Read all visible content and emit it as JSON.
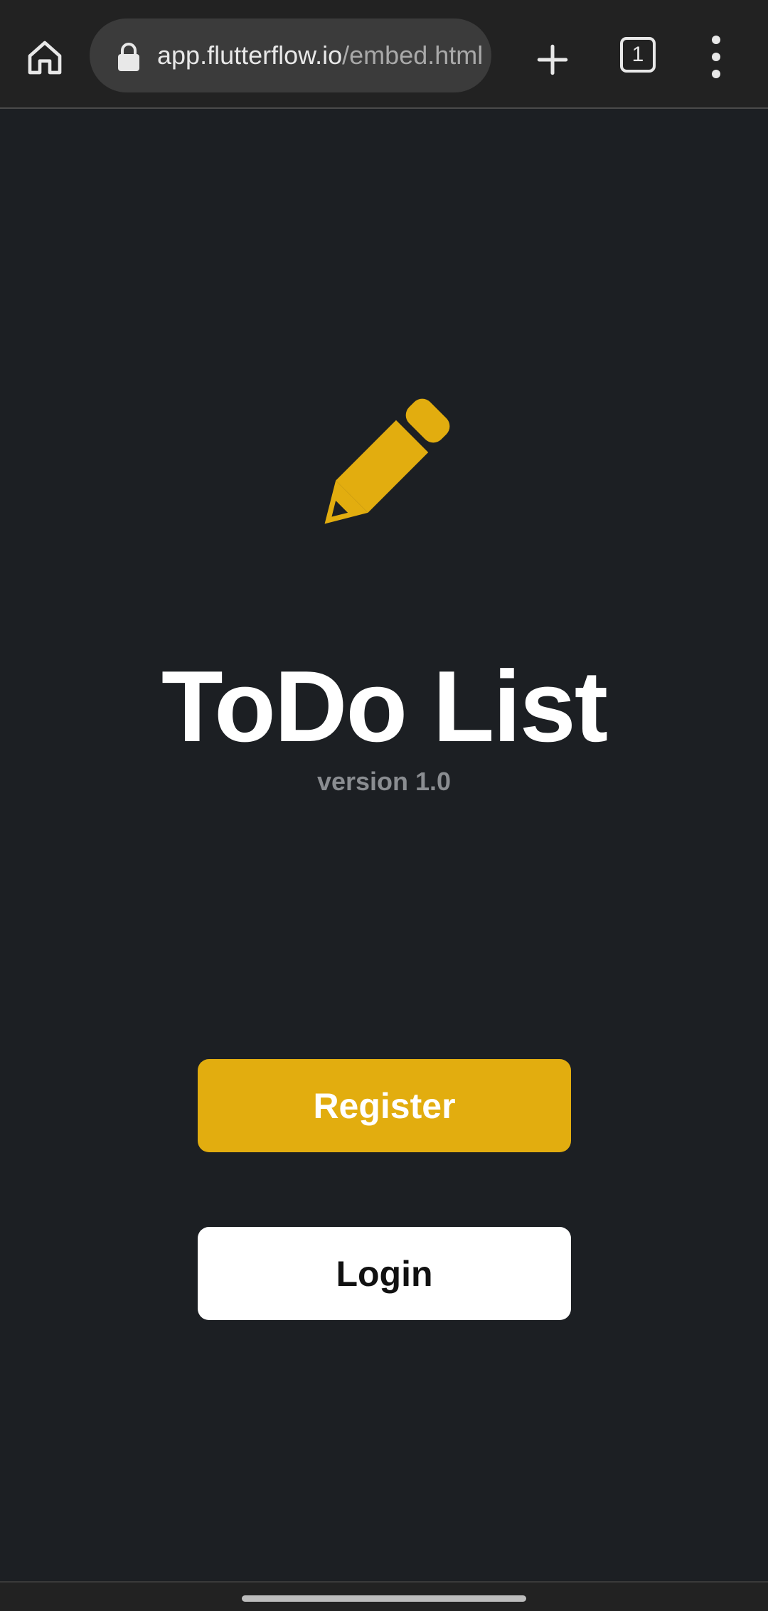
{
  "browser": {
    "url_host": "app.flutterflow.io",
    "url_path": "/embed.html",
    "tab_count": "1"
  },
  "app": {
    "title": "ToDo List",
    "version": "version 1.0",
    "register_label": "Register",
    "login_label": "Login"
  },
  "colors": {
    "background": "#1c1f23",
    "accent": "#e2ad0f",
    "login_bg": "#ffffff",
    "version_text": "#8a8d91"
  },
  "icons": {
    "home": "home-icon",
    "lock": "lock-icon",
    "plus": "plus-icon",
    "tabs": "tab-switcher-icon",
    "menu": "more-vert-icon",
    "logo": "pencil-icon"
  }
}
